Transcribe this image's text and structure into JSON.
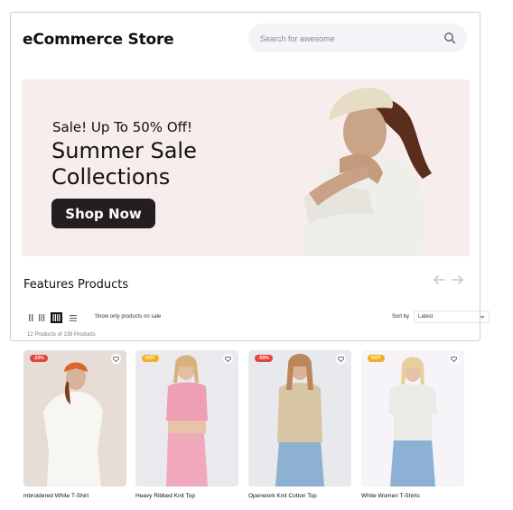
{
  "header": {
    "brand": "eCommerce Store",
    "search_placeholder": "Search for awesome"
  },
  "banner": {
    "eyebrow": "Sale! Up To 50% Off!",
    "headline": "Summer Sale Collections",
    "cta_label": "Shop Now"
  },
  "section": {
    "title": "Features Products"
  },
  "toolbar": {
    "filter_label": "Show only products on sale",
    "sort_label": "Sort by",
    "sort_value": "Latest",
    "count_text": "12 Products of 139 Products"
  },
  "products": [
    {
      "name": "mbroidered White T-Shirt",
      "badge": "-22%",
      "badge_color": "#e7433b"
    },
    {
      "name": "Heavy Ribbed Knit Top",
      "badge": "HOT",
      "badge_color": "#f2b01e"
    },
    {
      "name": "Openwork Knit Cotton Top",
      "badge": "-55%",
      "badge_color": "#e7433b"
    },
    {
      "name": "White Women T-Shirts",
      "badge": "HOT",
      "badge_color": "#f2b01e"
    }
  ]
}
